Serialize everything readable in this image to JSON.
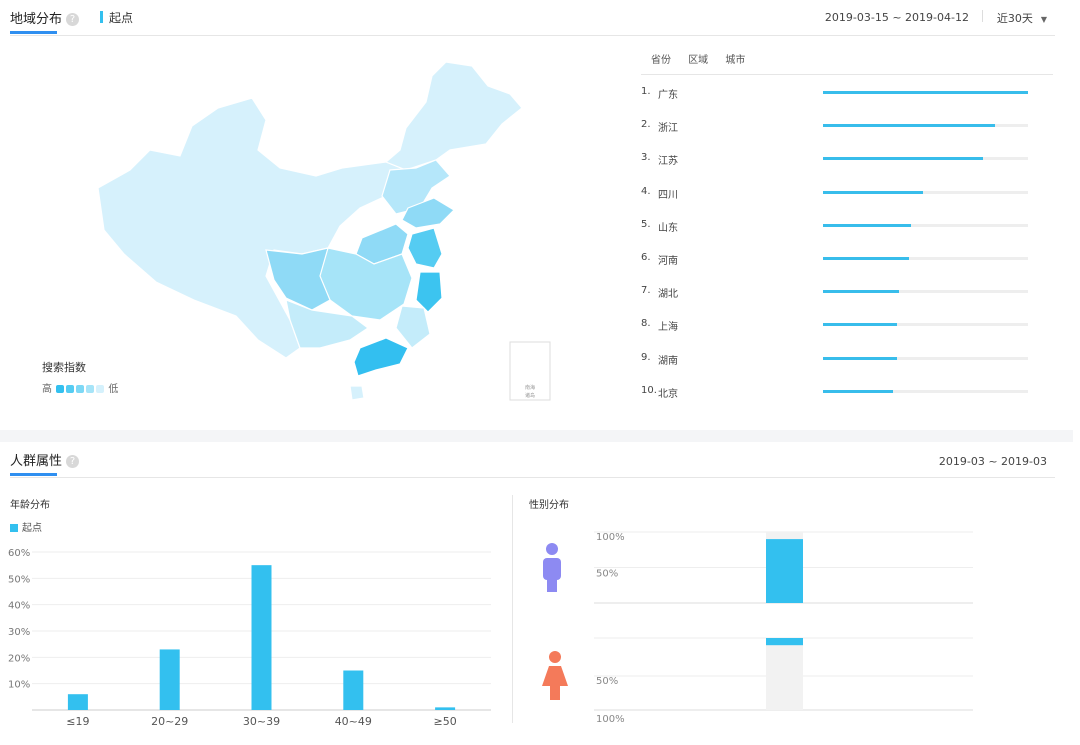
{
  "region": {
    "tab_title": "地域分布",
    "help": "?",
    "series_tag": "起点",
    "date_range": "2019-03-15 ~ 2019-04-12",
    "period": "近30天",
    "legend_title": "搜索指数",
    "legend_high": "高",
    "legend_low": "低",
    "legend_colors": [
      "#33c0ef",
      "#55ccf2",
      "#7dd8f5",
      "#a6e4f8",
      "#d5f1fc"
    ],
    "rank_tabs": [
      "省份",
      "区域",
      "城市"
    ],
    "ranking": [
      {
        "rank": "1.",
        "name": "广东",
        "value": 100
      },
      {
        "rank": "2.",
        "name": "浙江",
        "value": 84
      },
      {
        "rank": "3.",
        "name": "江苏",
        "value": 78
      },
      {
        "rank": "4.",
        "name": "四川",
        "value": 49
      },
      {
        "rank": "5.",
        "name": "山东",
        "value": 43
      },
      {
        "rank": "6.",
        "name": "河南",
        "value": 42
      },
      {
        "rank": "7.",
        "name": "湖北",
        "value": 37
      },
      {
        "rank": "8.",
        "name": "上海",
        "value": 36
      },
      {
        "rank": "9.",
        "name": "湖南",
        "value": 36
      },
      {
        "rank": "10.",
        "name": "北京",
        "value": 34
      }
    ],
    "inset_label_1": "南海",
    "inset_label_2": "诸岛"
  },
  "crowd": {
    "tab_title": "人群属性",
    "help": "?",
    "date_range": "2019-03 ~ 2019-03",
    "age_title": "年龄分布",
    "gender_title": "性别分布",
    "male_icon": "male-person-icon",
    "female_icon": "female-person-icon",
    "accent_color": "#33c0ef",
    "male_color": "#8d8af2",
    "female_color": "#f47a5a"
  },
  "chart_data": [
    {
      "type": "bar",
      "title": "年龄分布",
      "legend": [
        "起点"
      ],
      "categories": [
        "≤19",
        "20~29",
        "30~39",
        "40~49",
        "≥50"
      ],
      "series": [
        {
          "name": "起点",
          "values": [
            6,
            23,
            55,
            15,
            1
          ]
        }
      ],
      "ylim": [
        0,
        60
      ],
      "yticks": [
        "10%",
        "20%",
        "30%",
        "40%",
        "50%",
        "60%"
      ],
      "grid": true
    },
    {
      "type": "bar",
      "title": "性别分布",
      "series": [
        {
          "name": "male",
          "values": [
            90
          ]
        },
        {
          "name": "female",
          "values": [
            10
          ]
        }
      ],
      "male_ticks": [
        "100%",
        "50%"
      ],
      "female_ticks": [
        "50%",
        "100%"
      ],
      "ylim": [
        0,
        100
      ]
    }
  ]
}
